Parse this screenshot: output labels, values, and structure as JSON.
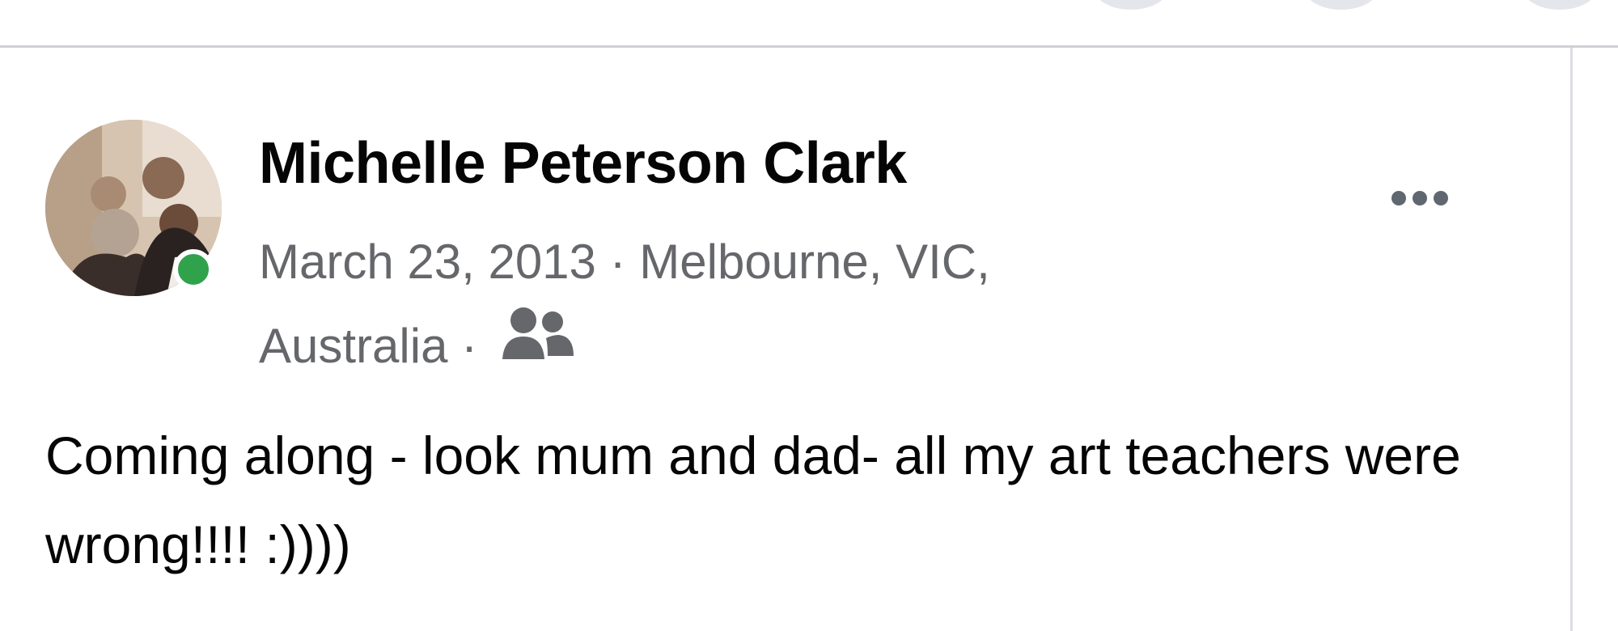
{
  "post": {
    "author_name": "Michelle Peterson Clark",
    "date": "March 23, 2013",
    "location_line1": "Melbourne, VIC,",
    "location_line2": "Australia",
    "separator": "·",
    "audience_icon": "friends-icon",
    "more_icon": "more-options-icon",
    "text": "Coming along - look mum and dad- all my art teachers were wrong!!!! :))))"
  },
  "colors": {
    "name": "#050505",
    "meta": "#65676b",
    "presence": "#31a24c",
    "divider": "#ced0d4"
  }
}
